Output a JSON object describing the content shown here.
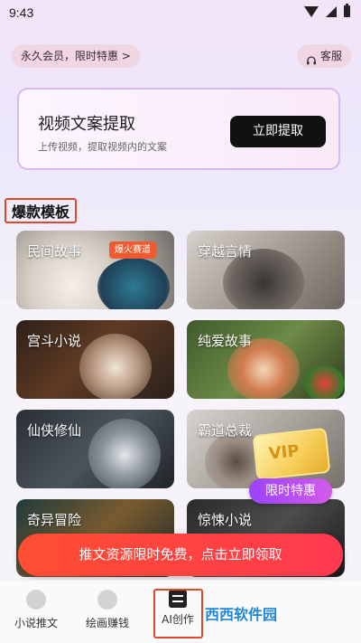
{
  "status": {
    "time": "9:43"
  },
  "top": {
    "vip_text": "永久会员，限时特惠 >",
    "service_text": "客服"
  },
  "extract": {
    "title": "视频文案提取",
    "subtitle": "上传视频，提取视频内的文案",
    "button": "立即提取"
  },
  "section": {
    "title": "爆款模板"
  },
  "templates": [
    {
      "label": "民间故事",
      "badge": "爆火赛道"
    },
    {
      "label": "穿越言情"
    },
    {
      "label": "宫斗小说"
    },
    {
      "label": "纯爱故事"
    },
    {
      "label": "仙侠修仙"
    },
    {
      "label": "霸道总裁"
    },
    {
      "label": "奇异冒险"
    },
    {
      "label": "惊悚小说"
    }
  ],
  "vip_sticker": {
    "text": "VIP",
    "badge": "限时特惠"
  },
  "promo": {
    "text": "推文资源限时免费，点击立即领取"
  },
  "nav": [
    {
      "label": "小说推文"
    },
    {
      "label": "绘画赚钱"
    },
    {
      "label": "AI创作"
    }
  ],
  "watermark": {
    "text": "西西软件园"
  }
}
